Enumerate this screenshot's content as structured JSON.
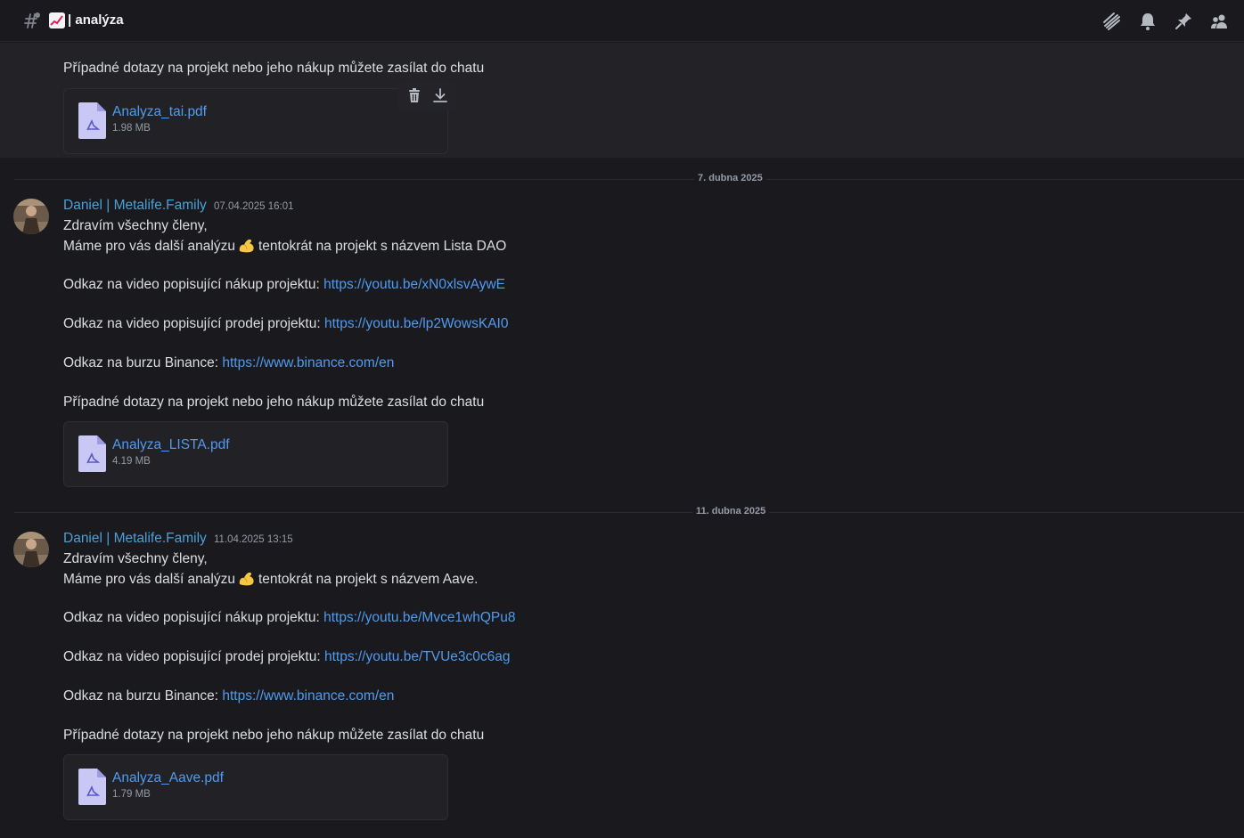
{
  "header": {
    "channel_icon": "hash-lock-icon",
    "channel_emoji": "chart-increasing-icon",
    "channel_name": "| analýza",
    "icons": [
      "threads-icon",
      "bell-icon",
      "pin-icon",
      "members-icon"
    ]
  },
  "messages": [
    {
      "question_line": "Případné dotazy na projekt nebo jeho nákup můžete zasílat do chatu",
      "attachment": {
        "name": "Analyza_tai.pdf",
        "size": "1.98 MB"
      }
    },
    {
      "date_divider": "7. dubna 2025",
      "author": "Daniel | Metalife.Family",
      "timestamp": "07.04.2025 16:01",
      "greeting": "Zdravím všechny členy,",
      "intro_before": "Máme pro vás další analýzu",
      "intro_after": "tentokrát na projekt s názvem Lista DAO",
      "buy_label": "Odkaz na video popisující nákup projektu:",
      "buy_link": "https://youtu.be/xN0xlsvAywE",
      "sell_label": "Odkaz na video popisující prodej projektu:",
      "sell_link": "https://youtu.be/lp2WowsKAI0",
      "exchange_label": "Odkaz na burzu Binance:",
      "exchange_link": "https://www.binance.com/en",
      "question_line": "Případné dotazy na projekt nebo jeho nákup můžete zasílat do chatu",
      "attachment": {
        "name": "Analyza_LISTA.pdf",
        "size": "4.19 MB"
      }
    },
    {
      "date_divider": "11. dubna 2025",
      "author": "Daniel | Metalife.Family",
      "timestamp": "11.04.2025 13:15",
      "greeting": "Zdravím všechny členy,",
      "intro_before": "Máme pro vás další analýzu",
      "intro_after": "tentokrát na projekt s názvem Aave.",
      "buy_label": "Odkaz na video popisující nákup projektu:",
      "buy_link": "https://youtu.be/Mvce1whQPu8",
      "sell_label": "Odkaz na video popisující prodej projektu:",
      "sell_link": "https://youtu.be/TVUe3c0c6ag",
      "exchange_label": "Odkaz na burzu Binance:",
      "exchange_link": "https://www.binance.com/en",
      "question_line": "Případné dotazy na projekt nebo jeho nákup můžete zasílat do chatu",
      "attachment": {
        "name": "Analyza_Aave.pdf",
        "size": "1.79 MB"
      }
    }
  ],
  "attachment_tools": [
    "trash-icon",
    "download-icon"
  ],
  "colors": {
    "link": "#4f9bf0",
    "username": "#4aa0d5",
    "background": "#1a1a1e"
  }
}
